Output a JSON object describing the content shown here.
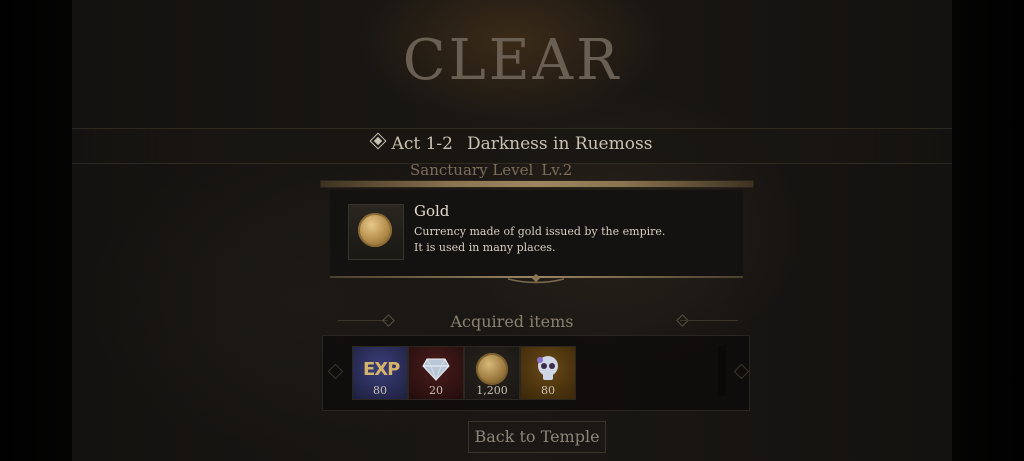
{
  "result": {
    "title": "CLEAR",
    "act_code": "Act 1-2",
    "act_name": "Darkness in Ruemoss",
    "sanctuary_label": "Sanctuary Level",
    "sanctuary_value": "Lv.2"
  },
  "selected_item": {
    "name": "Gold",
    "description_line1": "Currency made of gold issued by the empire.",
    "description_line2": "It is used in many places.",
    "icon": "gold-coin-icon"
  },
  "acquired": {
    "label": "Acquired items",
    "items": [
      {
        "icon": "exp-icon",
        "glyph": "EXP",
        "quantity": "80",
        "rarity_color": "#2a2e5a"
      },
      {
        "icon": "diamond-icon",
        "quantity": "20",
        "rarity_color": "#3a1616"
      },
      {
        "icon": "gold-coin-icon",
        "quantity": "1,200",
        "rarity_color": "#1c1a17"
      },
      {
        "icon": "skull-icon",
        "quantity": "80",
        "rarity_color": "#4a3412"
      }
    ]
  },
  "buttons": {
    "back": "Back to Temple"
  },
  "colors": {
    "accent_gold": "#9e8760",
    "background": "#0d0c0a"
  }
}
